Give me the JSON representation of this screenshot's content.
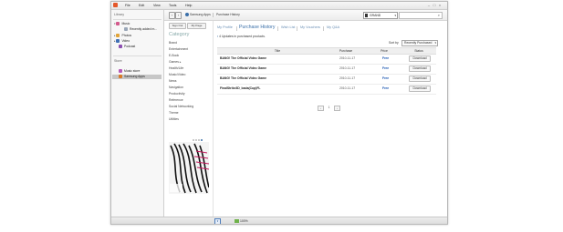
{
  "menubar": {
    "items": [
      "File",
      "Edit",
      "View",
      "Tools",
      "Help"
    ],
    "controls": [
      "–",
      "□",
      "×"
    ]
  },
  "library": {
    "library_header": "Library",
    "music": "Music",
    "recently_added": "Recently added m...",
    "photos": "Photos",
    "video": "Video",
    "podcast": "Podcast",
    "store_header": "Store",
    "music_store": "Music store",
    "samsung_apps": "Samsung Apps"
  },
  "toolbar": {
    "back": "‹",
    "forward": "›",
    "service": "Samsung Apps",
    "page": "Purchase History",
    "country": "GRAND",
    "search_placeholder": ""
  },
  "sidebar": {
    "sign_out": "Sign Out",
    "my_page": "My Page",
    "category_title": "Category",
    "categories": [
      "Brand",
      "Entertainment",
      "E-Book",
      "Games",
      "Health/Life",
      "Music/Video",
      "News",
      "Navigation",
      "Productivity",
      "Reference",
      "Social Networking",
      "Theme",
      "Utilities"
    ]
  },
  "tabs": [
    "My Profile",
    "Purchase History",
    "Wish List",
    "My Vouchers",
    "My Q&A"
  ],
  "summary": "4 Updates in purchased products.",
  "sort": {
    "label": "Sort by",
    "value": "Recently Purchased"
  },
  "table": {
    "headers": [
      "Title",
      "Purchase",
      "Price",
      "Status"
    ],
    "rows": [
      {
        "title": "BANG! The Official Video Game",
        "date": "2010-11-17",
        "price": "Free",
        "status": "Download"
      },
      {
        "title": "BANG! The Official Video Game",
        "date": "2010-11-17",
        "price": "Free",
        "status": "Download"
      },
      {
        "title": "BANG! The Official Video Game",
        "date": "2010-11-17",
        "price": "Free",
        "status": "Download"
      },
      {
        "title": "FinalStrike3D_bada(Cup)FL",
        "date": "2010-11-17",
        "price": "Free",
        "status": "Download"
      }
    ]
  },
  "pager": {
    "prev": "‹",
    "page": "1",
    "next": "›"
  },
  "statusbar": {
    "zoom": "100%"
  },
  "colors": {
    "accent": "#3a6fa8",
    "price": "#1a56b0",
    "app_icon": "#e4582b"
  }
}
